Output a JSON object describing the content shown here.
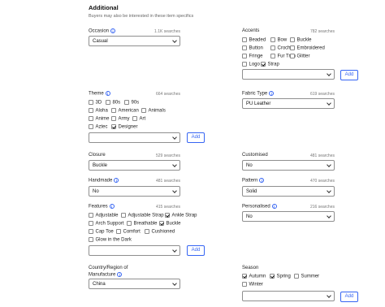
{
  "header": {
    "title": "Additional",
    "subtitle": "Buyers may also be interested in these item specifics"
  },
  "occasion": {
    "label": "Occasion",
    "count": "1.1K searches",
    "value": "Casual"
  },
  "accents": {
    "label": "Accents",
    "count": "782 searches",
    "options": [
      {
        "label": "Beaded",
        "checked": false
      },
      {
        "label": "Bow",
        "checked": false
      },
      {
        "label": "Buckle",
        "checked": false
      },
      {
        "label": "Button",
        "checked": false
      },
      {
        "label": "Crochet",
        "checked": false
      },
      {
        "label": "Embroidered",
        "checked": false
      },
      {
        "label": "Fringe",
        "checked": false
      },
      {
        "label": "Fur Trim",
        "checked": false
      },
      {
        "label": "Glitter",
        "checked": false
      },
      {
        "label": "Logo",
        "checked": false
      },
      {
        "label": "Strap",
        "checked": true
      }
    ],
    "add_label": "Add"
  },
  "theme": {
    "label": "Theme",
    "count": "664 searches",
    "options": [
      {
        "label": "3D",
        "checked": false
      },
      {
        "label": "80s",
        "checked": false
      },
      {
        "label": "90s",
        "checked": false
      },
      {
        "label": "Aloha",
        "checked": false
      },
      {
        "label": "American",
        "checked": false
      },
      {
        "label": "Animals",
        "checked": false
      },
      {
        "label": "Anime",
        "checked": false
      },
      {
        "label": "Army",
        "checked": false
      },
      {
        "label": "Art",
        "checked": false
      },
      {
        "label": "Aztec",
        "checked": false
      },
      {
        "label": "Designer",
        "checked": true
      }
    ],
    "add_label": "Add"
  },
  "fabric_type": {
    "label": "Fabric Type",
    "count": "619 searches",
    "value": "PU Leather"
  },
  "closure": {
    "label": "Closure",
    "count": "529 searches",
    "value": "Buckle"
  },
  "customised": {
    "label": "Customised",
    "count": "481 searches",
    "value": "No"
  },
  "handmade": {
    "label": "Handmade",
    "count": "481 searches",
    "value": "No"
  },
  "pattern": {
    "label": "Pattern",
    "count": "470 searches",
    "value": "Solid"
  },
  "features": {
    "label": "Features",
    "count": "415 searches",
    "options": [
      {
        "label": "Adjustable",
        "checked": false
      },
      {
        "label": "Adjustable Strap",
        "checked": false
      },
      {
        "label": "Ankle Strap",
        "checked": true
      },
      {
        "label": "Arch Support",
        "checked": false
      },
      {
        "label": "Breathable",
        "checked": false
      },
      {
        "label": "Buckle",
        "checked": true
      },
      {
        "label": "Cap Toe",
        "checked": false
      },
      {
        "label": "Comfort",
        "checked": false
      },
      {
        "label": "Cushioned",
        "checked": false
      },
      {
        "label": "Glow in the Dark",
        "checked": false
      }
    ],
    "add_label": "Add"
  },
  "personalised": {
    "label": "Personalised",
    "count": "216 searches",
    "value": "No"
  },
  "country": {
    "label_line1": "Country/Region of",
    "label_line2": "Manufacture",
    "value": "China"
  },
  "season": {
    "label": "Season",
    "options": [
      {
        "label": "Autumn",
        "checked": true
      },
      {
        "label": "Spring",
        "checked": true
      },
      {
        "label": "Summer",
        "checked": false
      },
      {
        "label": "Winter",
        "checked": false
      }
    ],
    "add_label": "Add"
  }
}
